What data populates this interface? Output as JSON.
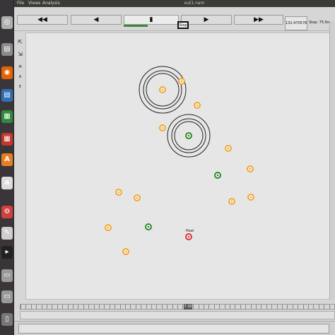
{
  "window": {
    "title": "out1.nam"
  },
  "menu": {
    "file": "File",
    "views": "Views",
    "analysis": "Analysis"
  },
  "toolbar": {
    "rewind_fast": "◀◀",
    "back": "◀",
    "stop": "▮",
    "play": "▶",
    "forward_fast": "▶▶",
    "stop_label": "Stop",
    "time": "132.470578",
    "step": "Step: 75.6ms",
    "progress": 0.44
  },
  "tools": [
    "⇱",
    "⇲",
    "M",
    "A",
    "E"
  ],
  "launcher": [
    {
      "name": "dash-home-icon",
      "glyph": "◎",
      "color": "#b0b0b0"
    },
    {
      "name": "files-icon",
      "glyph": "▤",
      "color": "#8a8a8a"
    },
    {
      "name": "firefox-icon",
      "glyph": "◉",
      "color": "#e66000"
    },
    {
      "name": "writer-icon",
      "glyph": "▤",
      "color": "#2f6fb5"
    },
    {
      "name": "calc-icon",
      "glyph": "▦",
      "color": "#2e8b3b"
    },
    {
      "name": "impress-icon",
      "glyph": "▦",
      "color": "#c0392b"
    },
    {
      "name": "software-center-icon",
      "glyph": "A",
      "color": "#e67e22"
    },
    {
      "name": "amazon-icon",
      "glyph": "a",
      "color": "#dddddd"
    },
    {
      "name": "settings-icon",
      "glyph": "⚙",
      "color": "#d04040"
    },
    {
      "name": "text-editor-icon",
      "glyph": "✎",
      "color": "#cfcfcf"
    },
    {
      "name": "terminal-icon",
      "glyph": "▸",
      "color": "#222222"
    },
    {
      "name": "drive-icon",
      "glyph": "▭",
      "color": "#9a9a9a"
    },
    {
      "name": "drive-icon-2",
      "glyph": "▭",
      "color": "#9a9a9a"
    },
    {
      "name": "trash-icon",
      "glyph": "▯",
      "color": "#777777"
    }
  ],
  "timeline": {
    "marker": "7:30"
  },
  "nodes": {
    "host_label": "Host"
  },
  "colors": {
    "orange_node": "#f0a830",
    "green_node": "#2e8b2e",
    "red_node": "#e03030",
    "progress": "#3d8c3d"
  }
}
